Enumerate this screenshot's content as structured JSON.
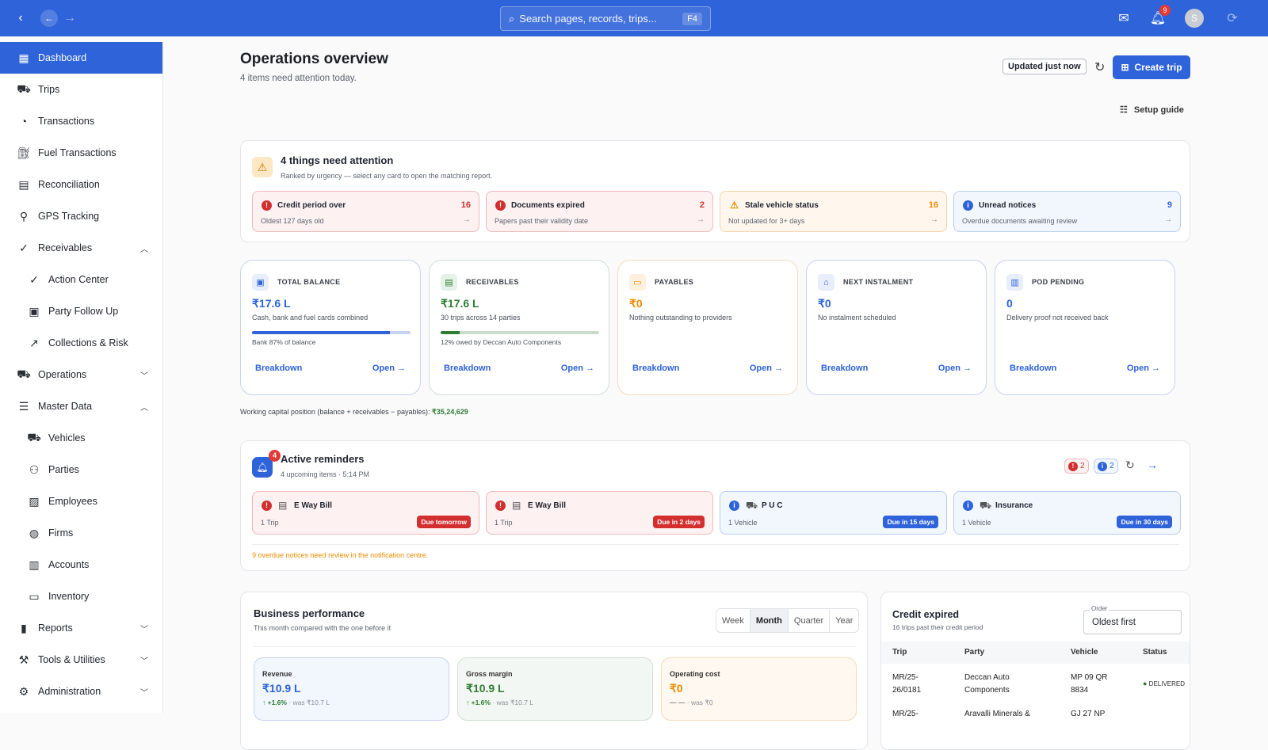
{
  "topbar": {
    "search_placeholder": "Search pages, records, trips...",
    "search_shortcut": "F4",
    "notification_count": "9",
    "avatar_initial": "S"
  },
  "sidebar": {
    "items": [
      {
        "label": "Dashboard",
        "icon": "dashboard-icon"
      },
      {
        "label": "Trips",
        "icon": "truck-icon"
      },
      {
        "label": "Transactions",
        "icon": "transactions-icon"
      },
      {
        "label": "Fuel Transactions",
        "icon": "fuel-icon"
      },
      {
        "label": "Reconciliation",
        "icon": "document-icon"
      },
      {
        "label": "GPS Tracking",
        "icon": "location-pin-icon"
      },
      {
        "label": "Receivables",
        "icon": "check-circle-icon"
      },
      {
        "label": "Action Center",
        "icon": "check-circle-icon"
      },
      {
        "label": "Party Follow Up",
        "icon": "contact-card-icon"
      },
      {
        "label": "Collections & Risk",
        "icon": "trending-up-icon"
      },
      {
        "label": "Operations",
        "icon": "truck-icon"
      },
      {
        "label": "Master Data",
        "icon": "list-icon"
      },
      {
        "label": "Vehicles",
        "icon": "truck-icon"
      },
      {
        "label": "Parties",
        "icon": "people-icon"
      },
      {
        "label": "Employees",
        "icon": "badge-icon"
      },
      {
        "label": "Firms",
        "icon": "globe-icon"
      },
      {
        "label": "Accounts",
        "icon": "wallet-icon"
      },
      {
        "label": "Inventory",
        "icon": "archive-icon"
      },
      {
        "label": "Reports",
        "icon": "bar-chart-icon"
      },
      {
        "label": "Tools & Utilities",
        "icon": "toolbox-icon"
      },
      {
        "label": "Administration",
        "icon": "admin-icon"
      }
    ]
  },
  "header": {
    "title": "Operations overview",
    "subtitle": "4 items need attention today.",
    "updated": "Updated just now",
    "create_label": "Create trip",
    "setup_label": "Setup guide"
  },
  "attention": {
    "title": "4 things need attention",
    "subtitle": "Ranked by urgency — select any card to open the matching report.",
    "cards": [
      {
        "title": "Credit period over",
        "sub": "Oldest 127 days old",
        "count": "16",
        "color": "#d32f2f"
      },
      {
        "title": "Documents expired",
        "sub": "Papers past their validity date",
        "count": "2",
        "color": "#d32f2f"
      },
      {
        "title": "Stale vehicle status",
        "sub": "Not updated for 3+ days",
        "count": "16",
        "color": "#ef8c00"
      },
      {
        "title": "Unread notices",
        "sub": "Overdue documents awaiting review",
        "count": "9",
        "color": "#2e63d9"
      }
    ]
  },
  "metrics": [
    {
      "label": "TOTAL BALANCE",
      "value": "₹17.6 L",
      "desc": "Cash, bank and fuel cards combined",
      "note": "Bank 87% of balance",
      "progress": 0.87,
      "color": "#2e63d9",
      "breakdown": "Breakdown",
      "open": "Open"
    },
    {
      "label": "RECEIVABLES",
      "value": "₹17.6 L",
      "desc": "30 trips across 14 parties",
      "note": "12% owed by Deccan Auto Components",
      "progress": 0.12,
      "color": "#2e7d32",
      "breakdown": "Breakdown",
      "open": "Open"
    },
    {
      "label": "PAYABLES",
      "value": "₹0",
      "desc": "Nothing outstanding to providers",
      "note": "",
      "progress": null,
      "color": "#ef8c00",
      "breakdown": "Breakdown",
      "open": "Open"
    },
    {
      "label": "NEXT INSTALMENT",
      "value": "₹0",
      "desc": "No instalment scheduled",
      "note": "",
      "progress": null,
      "color": "#2e63d9",
      "breakdown": "Breakdown",
      "open": "Open"
    },
    {
      "label": "POD PENDING",
      "value": "0",
      "desc": "Delivery proof not received back",
      "note": "",
      "progress": null,
      "color": "#2e63d9",
      "breakdown": "Breakdown",
      "open": "Open"
    }
  ],
  "working_capital": {
    "text": "Working capital position (balance + receivables − payables): ",
    "value": "₹35,24,629"
  },
  "reminders": {
    "title": "Active reminders",
    "subtitle": "4 upcoming items · 5:14 PM",
    "badge": "4",
    "red_count": "2",
    "blue_count": "2",
    "overdue_note": "9 overdue notices need review in the notification centre.",
    "cards": [
      {
        "title": "E Way Bill",
        "sub": "1 Trip",
        "due": "Due tomorrow",
        "kind": "red"
      },
      {
        "title": "E Way Bill",
        "sub": "1 Trip",
        "due": "Due in 2 days",
        "kind": "red"
      },
      {
        "title": "P U C",
        "sub": "1 Vehicle",
        "due": "Due in 15 days",
        "kind": "blue"
      },
      {
        "title": "Insurance",
        "sub": "1 Vehicle",
        "due": "Due in 30 days",
        "kind": "blue"
      }
    ]
  },
  "performance": {
    "title": "Business performance",
    "subtitle": "This month compared with the one before it",
    "periods": [
      "Week",
      "Month",
      "Quarter",
      "Year"
    ],
    "selected": "Month",
    "cards": [
      {
        "label": "Revenue",
        "value": "₹10.9 L",
        "delta": "↑ +1.6%",
        "was": "· was ₹10.7 L"
      },
      {
        "label": "Gross margin",
        "value": "₹10.9 L",
        "delta": "↑ +1.6%",
        "was": "· was ₹10.7 L"
      },
      {
        "label": "Operating cost",
        "value": "₹0",
        "delta": "— —",
        "was": "· was ₹0"
      }
    ]
  },
  "credit": {
    "title": "Credit expired",
    "subtitle": "16 trips past their credit period",
    "order_label": "Order",
    "order_value": "Oldest first",
    "columns": [
      "Trip",
      "Party",
      "Vehicle",
      "Status"
    ],
    "rows": [
      {
        "trip": "MR/25-\n26/0181",
        "party": "Deccan Auto\nComponents",
        "vehicle": "MP 09 QR\n8834",
        "status": "DELIVERED"
      },
      {
        "trip": "MR/25-",
        "party": "Aravalli Minerals &",
        "vehicle": "GJ 27 NP",
        "status": ""
      }
    ]
  }
}
